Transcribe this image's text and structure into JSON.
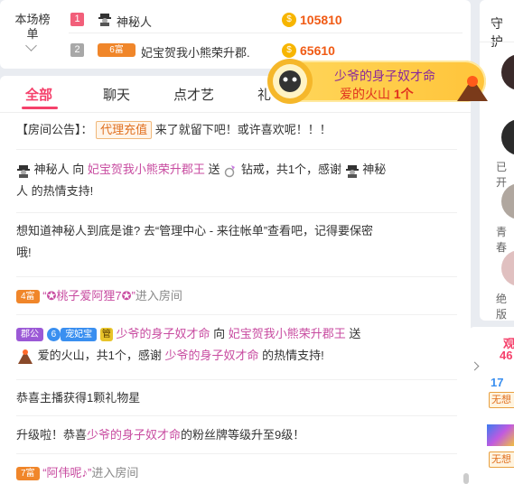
{
  "rank": {
    "label": "本场榜单",
    "rows": [
      {
        "num": "1",
        "name": "神秘人",
        "score": "105810",
        "num_color": "#f25f7a"
      },
      {
        "num": "2",
        "badge": "6富",
        "name": "妃宝贺我小熊荣升郡.",
        "score": "65610",
        "num_color": "#a8a8a8"
      }
    ]
  },
  "tabs": [
    "全部",
    "聊天",
    "点才艺",
    "礼"
  ],
  "messages": {
    "announce_prefix": "【房间公告】：",
    "announce_btn": "代理充值",
    "announce_text": "来了就留下吧！或许喜欢呢！！！",
    "m1_a": "神秘人",
    "m1_b": "向",
    "m1_c": "妃宝贺我小熊荣升郡王",
    "m1_d": "送",
    "m1_e": "钻戒，共1个，感谢",
    "m1_f": "神秘",
    "m1_g": "人 的热情支持!",
    "m2_line1": "想知道神秘人到底是谁? 去“管理中心 - 来往帐单”查看吧，记得要保密",
    "m2_line2": "哦!",
    "m3_badge": "4富",
    "m3_name": "“✪桃子爱阿狸7✪”",
    "m3_rest": "进入房间",
    "m4_b1": "郡公",
    "m4_b2": "6",
    "m4_b3": "宠妃宝",
    "m4_b4": "管",
    "m4_a": "少爷的身子奴才命",
    "m4_b": "向",
    "m4_c": "妃宝贺我小熊荣升郡王",
    "m4_d": "送",
    "m4_e": "爱的火山，共1个，感谢",
    "m4_f": "少爷的身子奴才命",
    "m4_g": "的热情支持!",
    "m5": "恭喜主播获得1颗礼物星",
    "m6_a": "升级啦！恭喜",
    "m6_b": "少爷的身子奴才命",
    "m6_c": "的粉丝牌等级升至9级！",
    "m7_badge": "7富",
    "m7_name": "“阿伟呢♪”",
    "m7_rest": "进入房间"
  },
  "banner": {
    "name": "少爷的身子奴才命",
    "gift": "爱的火山",
    "count": "1个"
  },
  "right": {
    "title": "守护",
    "label1": "已开",
    "label2": "青春",
    "label3": "绝版",
    "watch_title": "观",
    "watch_num": "46",
    "item_num": "17",
    "tag1": "无想",
    "tag2": "无想"
  },
  "colors": {
    "accent": "#f5416b",
    "score": "#f05a14",
    "pink_name": "#c84ba0"
  }
}
